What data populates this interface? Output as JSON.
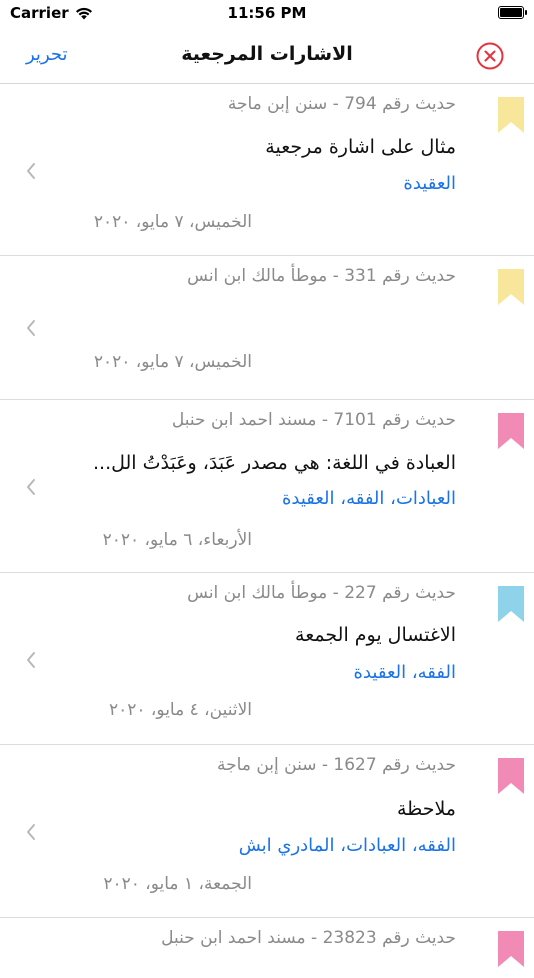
{
  "status": {
    "carrier": "Carrier",
    "time": "11:56 PM"
  },
  "nav": {
    "title": "الاشارات المرجعية",
    "edit": "تحرير"
  },
  "colors": {
    "accent": "#1a73e8",
    "close": "#e5323b"
  },
  "bookmarks": [
    {
      "ref": "حديث رقم  794 - سنن إبن ماجة",
      "note": "مثال على اشارة مرجعية",
      "tags": "العقيدة",
      "date": "الخميس، ٧ مايو، ٢٠٢٠",
      "color": "#f8e79a"
    },
    {
      "ref": "حديث رقم  331 - موطأ مالك ابن انس",
      "note": "",
      "tags": "",
      "date": "الخميس، ٧ مايو، ٢٠٢٠",
      "color": "#f8e79a"
    },
    {
      "ref": "حديث رقم  7101 - مسند احمد ابن حنبل",
      "note": "العبادة في اللغة: هي مصدر عَبَدَ، وعَبَدْتُ الل...",
      "tags": "العبادات، الفقه، العقيدة",
      "date": "الأربعاء، ٦ مايو، ٢٠٢٠",
      "color": "#f28ab6"
    },
    {
      "ref": "حديث رقم  227 - موطأ مالك ابن انس",
      "note": "الاغتسال يوم الجمعة",
      "tags": "الفقه، العقيدة",
      "date": "الاثنين، ٤ مايو، ٢٠٢٠",
      "color": "#8ed3ea"
    },
    {
      "ref": "حديث رقم  1627 - سنن إبن ماجة",
      "note": "ملاحظة",
      "tags": "الفقه، العبادات، المادري ابش",
      "date": "الجمعة، ١ مايو، ٢٠٢٠",
      "color": "#f28ab6"
    },
    {
      "ref": "حديث رقم  23823 - مسند احمد ابن حنبل",
      "note": "",
      "tags": "",
      "date": "",
      "color": "#f28ab6"
    }
  ]
}
